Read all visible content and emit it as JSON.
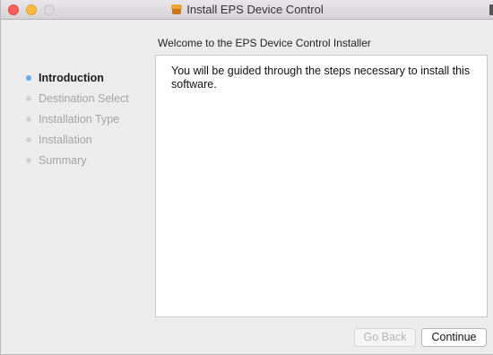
{
  "window": {
    "title": "Install EPS Device Control"
  },
  "subtitle": "Welcome to the EPS Device Control Installer",
  "steps": [
    {
      "label": "Introduction",
      "active": true
    },
    {
      "label": "Destination Select",
      "active": false
    },
    {
      "label": "Installation Type",
      "active": false
    },
    {
      "label": "Installation",
      "active": false
    },
    {
      "label": "Summary",
      "active": false
    }
  ],
  "content": {
    "body": "You will be guided through the steps necessary to install this software."
  },
  "buttons": {
    "go_back": "Go Back",
    "continue": "Continue"
  },
  "icons": {
    "title_icon": "installer-package-icon",
    "lock_icon": "lock-icon"
  },
  "colors": {
    "active_step_dot": "#6aa9ea",
    "inactive_step_dot": "#d2d2d2",
    "close_button": "#fc605c",
    "minimize_button": "#fdbc40"
  }
}
